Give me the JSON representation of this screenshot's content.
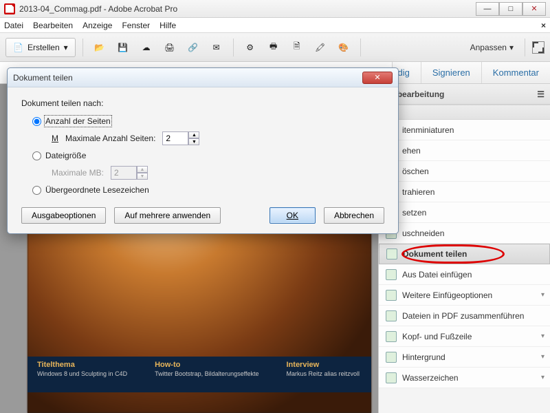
{
  "window": {
    "title": "2013-04_Commag.pdf - Adobe Acrobat Pro"
  },
  "menu": {
    "file": "Datei",
    "edit": "Bearbeiten",
    "view": "Anzeige",
    "window": "Fenster",
    "help": "Hilfe"
  },
  "toolbar": {
    "create": "Erstellen",
    "customize": "Anpassen"
  },
  "tabs": {
    "partial": "dig",
    "sign": "Signieren",
    "comment": "Kommentar"
  },
  "right_panel": {
    "heading_partial": "sbearbeitung",
    "tools": [
      {
        "label": "itenminiaturen",
        "chev": false
      },
      {
        "label": "ehen",
        "chev": false
      },
      {
        "label": "öschen",
        "chev": false
      },
      {
        "label": "trahieren",
        "chev": false
      },
      {
        "label": "setzen",
        "chev": false
      },
      {
        "label": "uschneiden",
        "chev": false
      },
      {
        "label": "Dokument teilen",
        "chev": false,
        "active": true,
        "circled": true
      },
      {
        "label": "Aus Datei einfügen",
        "chev": false
      },
      {
        "label": "Weitere Einfügeoptionen",
        "chev": true
      },
      {
        "label": "Dateien in PDF zusammenführen",
        "chev": false
      },
      {
        "label": "Kopf- und Fußzeile",
        "chev": true
      },
      {
        "label": "Hintergrund",
        "chev": true
      },
      {
        "label": "Wasserzeichen",
        "chev": true
      }
    ]
  },
  "doc_footer": {
    "c1h": "Titelthema",
    "c1s": "Windows 8 und Sculpting in C4D",
    "c2h": "How-to",
    "c2s": "Twitter Bootstrap, Bildalterungseffekte",
    "c3h": "Interview",
    "c3s": "Markus Reitz alias reitzvoll"
  },
  "dialog": {
    "title": "Dokument teilen",
    "prompt": "Dokument teilen nach:",
    "opt_pages": "Anzahl der Seiten",
    "max_pages_label": "Maximale Anzahl Seiten:",
    "max_pages_value": "2",
    "opt_size": "Dateigröße",
    "max_mb_label": "Maximale MB:",
    "max_mb_value": "2",
    "opt_bookmarks": "Übergeordnete Lesezeichen",
    "btn_output": "Ausgabeoptionen",
    "btn_multi": "Auf mehrere anwenden",
    "btn_ok": "OK",
    "btn_cancel": "Abbrechen"
  }
}
